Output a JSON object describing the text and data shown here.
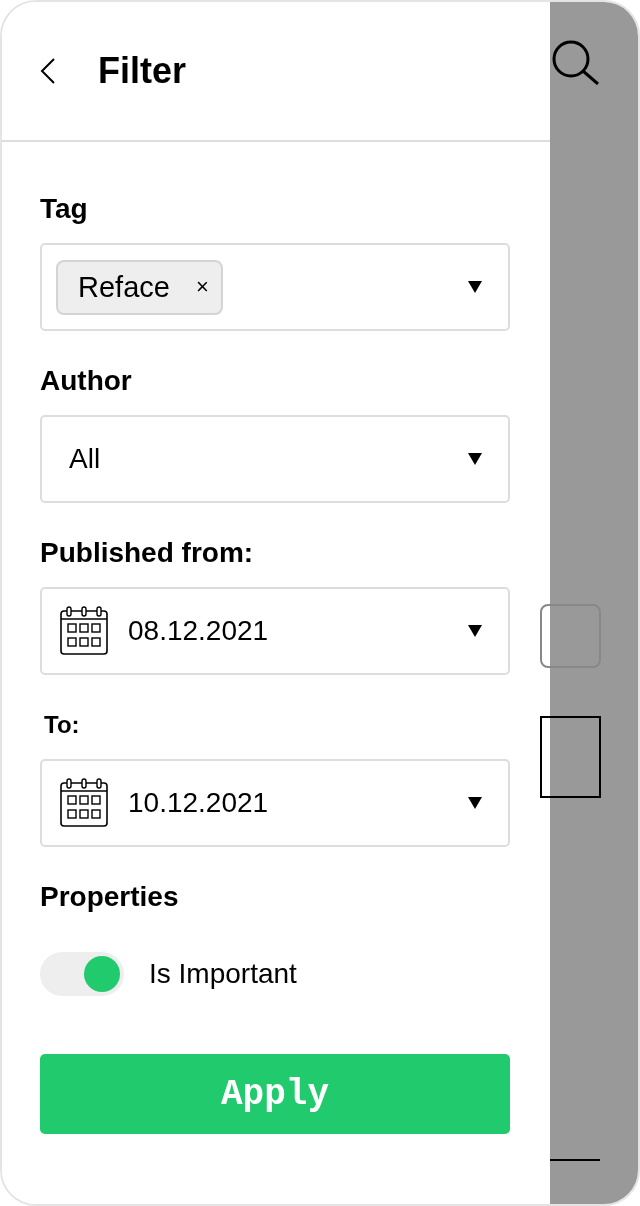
{
  "header": {
    "title": "Filter"
  },
  "fields": [
    {
      "kind": "tags",
      "label": "Tag",
      "tags": [
        {
          "text": "Reface",
          "remove": "×"
        }
      ]
    },
    {
      "kind": "select",
      "label": "Author",
      "value": "All"
    },
    {
      "kind": "date",
      "label": "Published from:",
      "value": "08.12.2021"
    },
    {
      "kind": "date",
      "label": "To:",
      "value": "10.12.2021"
    }
  ],
  "properties": {
    "label": "Properties",
    "toggles": [
      {
        "label": "Is Important",
        "on": true
      }
    ]
  },
  "apply_button": "Apply"
}
